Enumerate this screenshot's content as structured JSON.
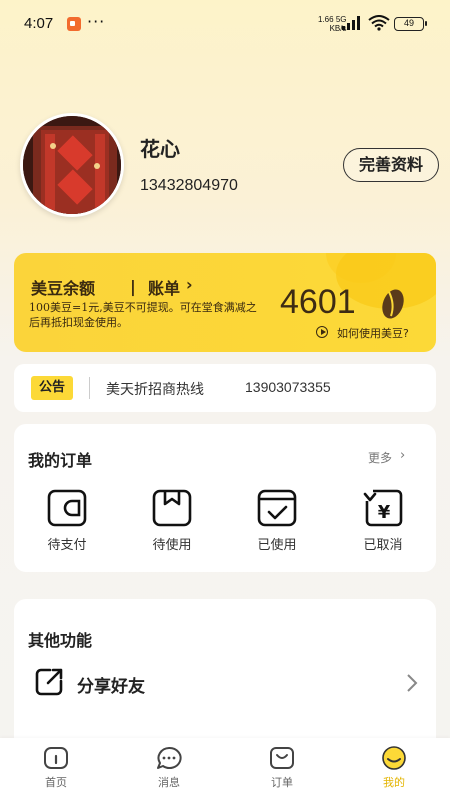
{
  "status_bar": {
    "time": "4:07",
    "more": "···",
    "net_speed": "1.66",
    "net_unit": "KB/s",
    "net_type": "5G",
    "battery": "49"
  },
  "profile": {
    "name": "花心",
    "phone": "13432804970",
    "complete_button": "完善资料"
  },
  "beans": {
    "title": "美豆余额",
    "separator": "|",
    "bill": "账单",
    "description": "100美豆=1元,美豆不可提现。可在堂食满减之后再抵扣现金使用。",
    "value": "4601",
    "how_to_use": "如何使用美豆?"
  },
  "notice": {
    "tag": "公告",
    "text": "美天折招商热线",
    "phone": "13903073355"
  },
  "orders": {
    "title": "我的订单",
    "more": "更多",
    "items": [
      {
        "label": "待支付",
        "icon": "wallet-icon"
      },
      {
        "label": "待使用",
        "icon": "bookmark-icon"
      },
      {
        "label": "已使用",
        "icon": "check-box-icon"
      },
      {
        "label": "已取消",
        "icon": "yuan-refund-icon"
      }
    ]
  },
  "other": {
    "title": "其他功能",
    "share_label": "分享好友"
  },
  "tabbar": {
    "items": [
      {
        "label": "首页",
        "icon": "home-icon"
      },
      {
        "label": "消息",
        "icon": "message-icon"
      },
      {
        "label": "订单",
        "icon": "order-icon"
      },
      {
        "label": "我的",
        "icon": "profile-smile-icon",
        "active": true
      }
    ]
  },
  "colors": {
    "accent_yellow": "#fcd937",
    "active_tab": "#e3b400",
    "bean_brown": "#5a3a1a"
  }
}
